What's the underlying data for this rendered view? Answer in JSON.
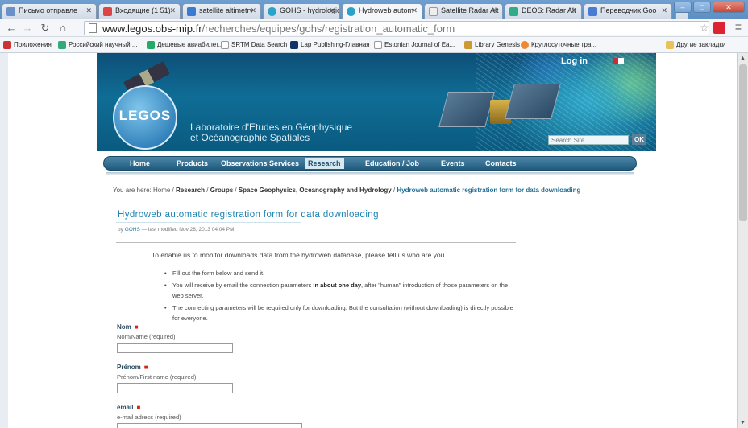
{
  "browser": {
    "tabs": [
      {
        "title": "Письмо отправле",
        "active": false,
        "color": "#6a90c8"
      },
      {
        "title": "Входящие (1 51)",
        "active": false,
        "color": "#d44"
      },
      {
        "title": "satellite altimetry",
        "active": false,
        "color": "#3a7ad1"
      },
      {
        "title": "GOHS - hydrologic",
        "active": false,
        "color": "#2aa3c8"
      },
      {
        "title": "Hydroweb autom",
        "active": true,
        "color": "#2aa3c8"
      },
      {
        "title": "Satellite Radar Alt",
        "active": false,
        "color": "#aaa"
      },
      {
        "title": "DEOS: Radar Alt",
        "active": false,
        "color": "#3a8"
      },
      {
        "title": "Переводчик Goo",
        "active": false,
        "color": "#4a7ad1"
      }
    ],
    "url": {
      "host": "www.legos.obs-mip.fr",
      "path": "/recherches/equipes/gohs/registration_automatic_form"
    },
    "bookmarks": [
      {
        "label": "Приложения",
        "color": "#c33"
      },
      {
        "label": "Российский научный ...",
        "color": "#3a7"
      },
      {
        "label": "Дешевые авиабилет...",
        "color": "#2a6"
      },
      {
        "label": "SRTM Data Search",
        "color": "#aaa"
      },
      {
        "label": "Lap Publishing-Главная",
        "color": "#136"
      },
      {
        "label": "Estonian Journal of Ea...",
        "color": "#aaa"
      },
      {
        "label": "Library Genesis",
        "color": "#c93"
      },
      {
        "label": "Круглосуточные тра...",
        "color": "#e83"
      }
    ],
    "bookmarks_other": "Другие закладки"
  },
  "site": {
    "logo": "LEGOS",
    "lab_name": [
      "Laboratoire d'Etudes en Géophysique",
      "et Océanographie Spatiales"
    ],
    "login": "Log in",
    "search_placeholder": "Search Site",
    "search_button": "OK",
    "nav": [
      {
        "label": "Home",
        "active": false
      },
      {
        "label": "Products",
        "active": false
      },
      {
        "label": "Observations Services",
        "active": false
      },
      {
        "label": "Research",
        "active": true
      },
      {
        "label": "Education / Job",
        "active": false
      },
      {
        "label": "Events",
        "active": false
      },
      {
        "label": "Contacts",
        "active": false
      }
    ],
    "breadcrumb": {
      "prefix": "You are here:",
      "items": [
        "Home",
        "Research",
        "Groups",
        "Space Geophysics, Oceanography and Hydrology"
      ],
      "current": "Hydroweb automatic registration form for data downloading"
    }
  },
  "content": {
    "title": "Hydroweb automatic registration form for data downloading",
    "byline": {
      "by": "by",
      "author": "GOHS",
      "modified": "— last modified Nov 28, 2013 04:04 PM"
    },
    "intro": "To enable us to monitor downloads data from the hydroweb database, please tell us who are you.",
    "bullets": [
      {
        "text": "Fill out the form below and send it."
      },
      {
        "pre": "You will receive by email the connection parameters ",
        "bold": "in about one day",
        "post": ", after \"human\" introduction of those parameters on the web server."
      },
      {
        "text": "The connecting parameters will be required only for downloading. But the consultation (without downloading) is directly possible for everyone."
      }
    ],
    "fields": [
      {
        "label": "Nom",
        "hint": "Nom/Name (required)"
      },
      {
        "label": "Prénom",
        "hint": "Prénom/First name (required)"
      },
      {
        "label": "email",
        "hint": "e-mail adress (required)"
      }
    ],
    "required_marker": "■"
  }
}
